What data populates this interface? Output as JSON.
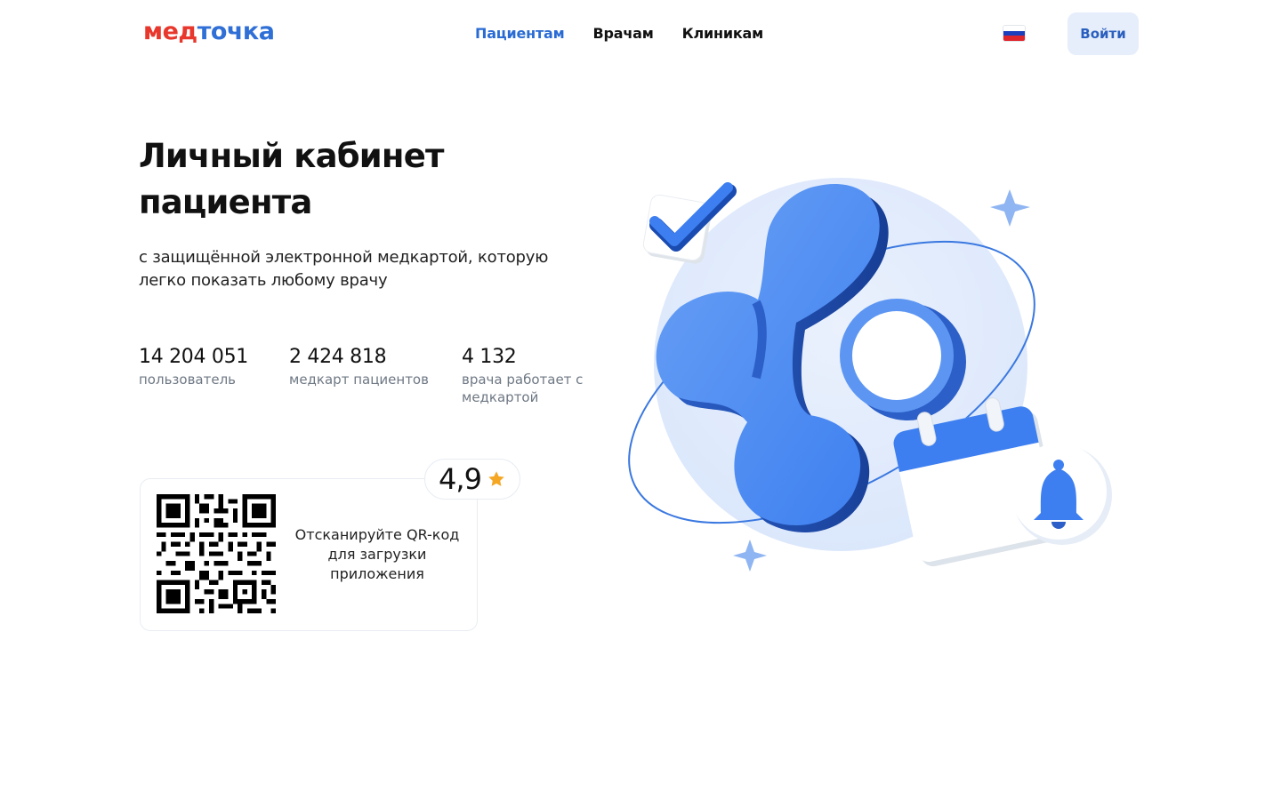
{
  "header": {
    "logo_part1": "мед",
    "logo_part2": "точка",
    "nav": [
      {
        "label": "Пациентам",
        "active": true
      },
      {
        "label": "Врачам",
        "active": false
      },
      {
        "label": "Клиникам",
        "active": false
      }
    ],
    "language_icon": "russian-flag-icon",
    "login_label": "Войти"
  },
  "hero": {
    "title": "Личный кабинет пациента",
    "subtitle": "с защищённой электронной медкартой, которую легко показать любому врачу"
  },
  "stats": [
    {
      "value": "14 204 051",
      "label": "пользователь"
    },
    {
      "value": "2 424 818",
      "label": "медкарт пациентов"
    },
    {
      "value": "4 132",
      "label": "врача работает с медкартой"
    }
  ],
  "app": {
    "qr_text": "Отсканируйте QR-код для загрузки приложения",
    "rating": "4,9",
    "rating_icon": "star-icon"
  },
  "colors": {
    "brand_red": "#e8372c",
    "brand_blue": "#2f6fd6",
    "accent_blue": "#2a6bd3",
    "star": "#f5a623"
  }
}
